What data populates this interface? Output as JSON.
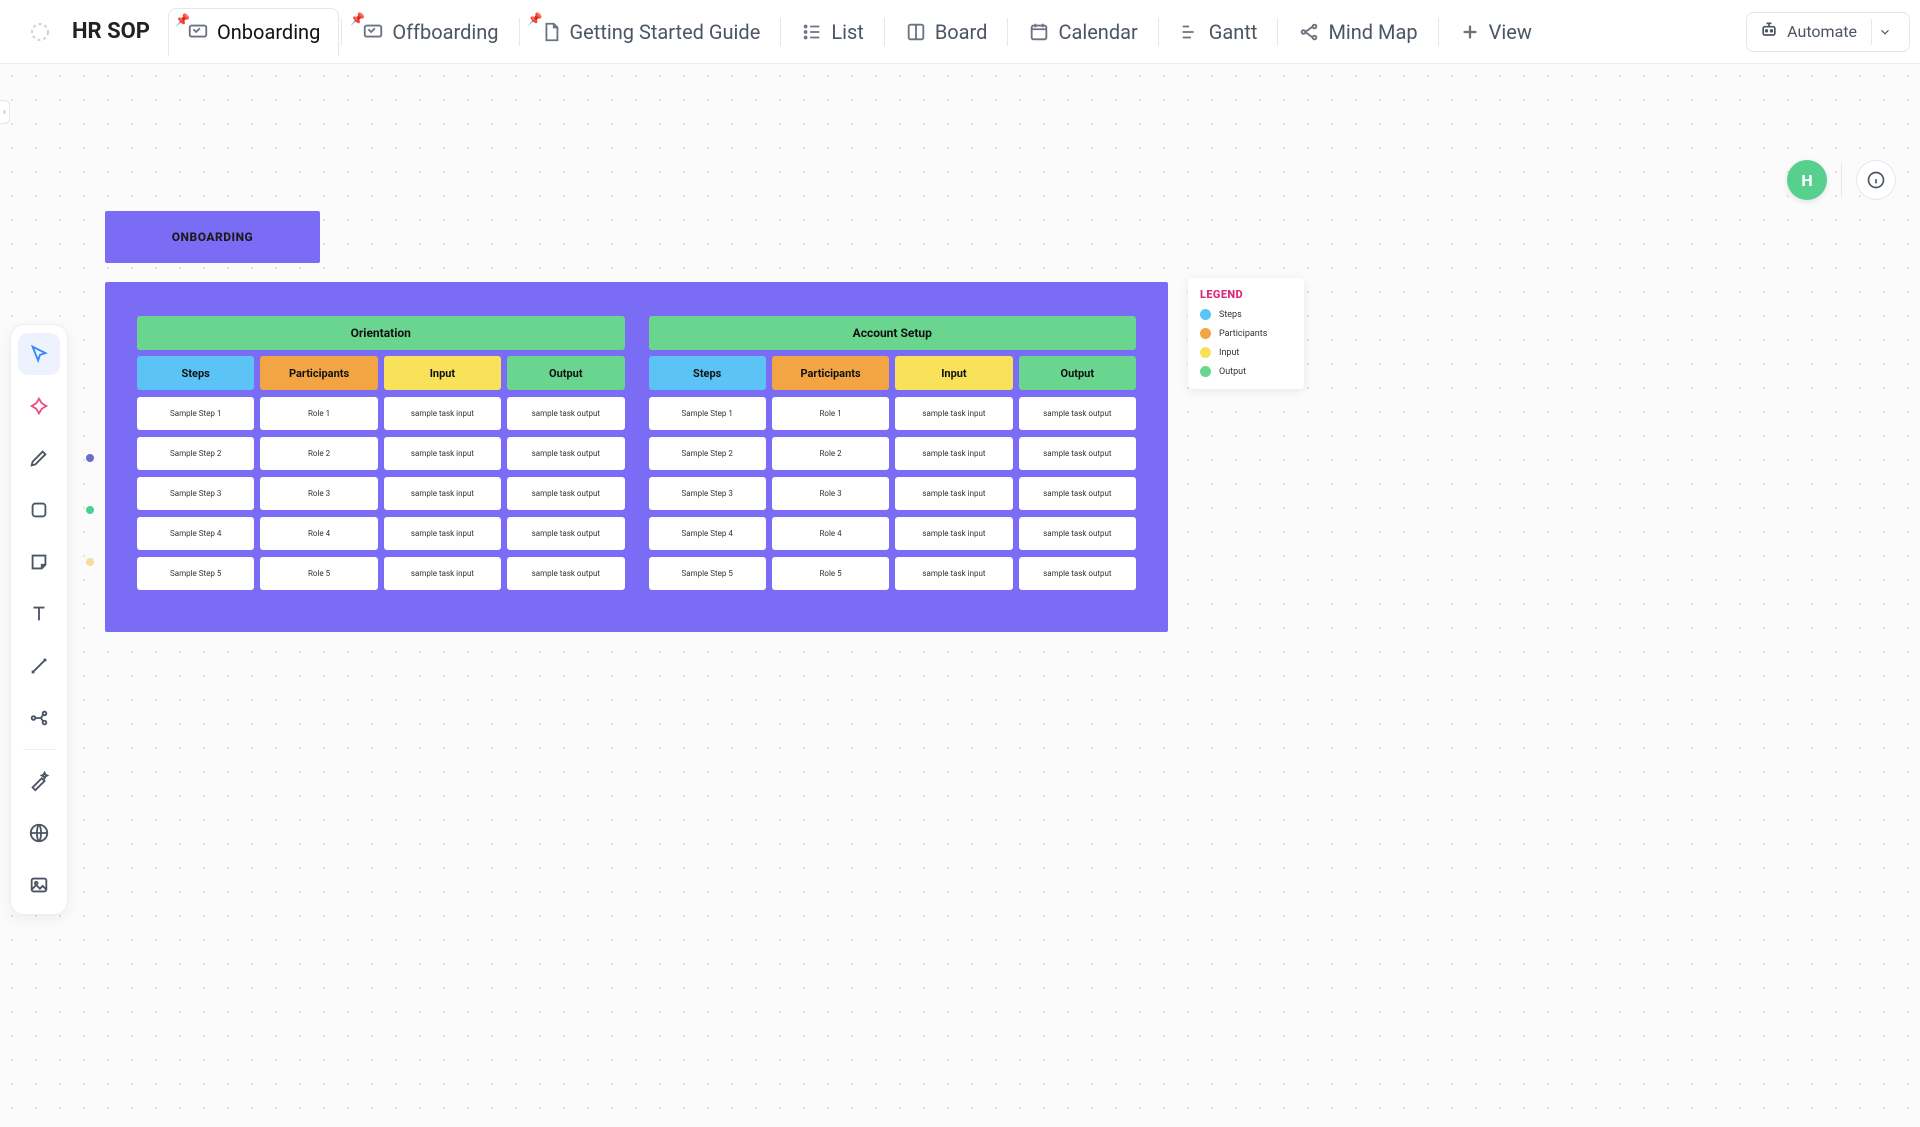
{
  "app": {
    "title": "HR SOP"
  },
  "tabs": {
    "onboarding": "Onboarding",
    "offboarding": "Offboarding",
    "guide": "Getting Started Guide",
    "list": "List",
    "board": "Board",
    "calendar": "Calendar",
    "gantt": "Gantt",
    "mindmap": "Mind Map",
    "addview": "View"
  },
  "automate": {
    "label": "Automate"
  },
  "avatar": {
    "initial": "H"
  },
  "boardLabel": "ONBOARDING",
  "columns": {
    "steps": "Steps",
    "participants": "Participants",
    "input": "Input",
    "output": "Output"
  },
  "sections": [
    {
      "title": "Orientation",
      "rows": [
        {
          "step": "Sample Step 1",
          "role": "Role 1",
          "input": "sample task input",
          "output": "sample task output"
        },
        {
          "step": "Sample Step 2",
          "role": "Role 2",
          "input": "sample task input",
          "output": "sample task output"
        },
        {
          "step": "Sample Step 3",
          "role": "Role 3",
          "input": "sample task input",
          "output": "sample task output"
        },
        {
          "step": "Sample Step 4",
          "role": "Role 4",
          "input": "sample task input",
          "output": "sample task output"
        },
        {
          "step": "Sample Step 5",
          "role": "Role 5",
          "input": "sample task input",
          "output": "sample task output"
        }
      ]
    },
    {
      "title": "Account Setup",
      "rows": [
        {
          "step": "Sample Step 1",
          "role": "Role 1",
          "input": "sample task input",
          "output": "sample task output"
        },
        {
          "step": "Sample Step 2",
          "role": "Role 2",
          "input": "sample task input",
          "output": "sample task output"
        },
        {
          "step": "Sample Step 3",
          "role": "Role 3",
          "input": "sample task input",
          "output": "sample task output"
        },
        {
          "step": "Sample Step 4",
          "role": "Role 4",
          "input": "sample task input",
          "output": "sample task output"
        },
        {
          "step": "Sample Step 5",
          "role": "Role 5",
          "input": "sample task input",
          "output": "sample task output"
        }
      ]
    }
  ],
  "legend": {
    "title": "LEGEND",
    "items": [
      {
        "label": "Steps",
        "color": "#5cc3f7"
      },
      {
        "label": "Participants",
        "color": "#f2a542"
      },
      {
        "label": "Input",
        "color": "#f7e25a"
      },
      {
        "label": "Output",
        "color": "#69d58e"
      }
    ]
  },
  "tooldots": {
    "pen": "#6b6bd6",
    "shape": "#49d190",
    "sticky": "#f3dca0"
  }
}
